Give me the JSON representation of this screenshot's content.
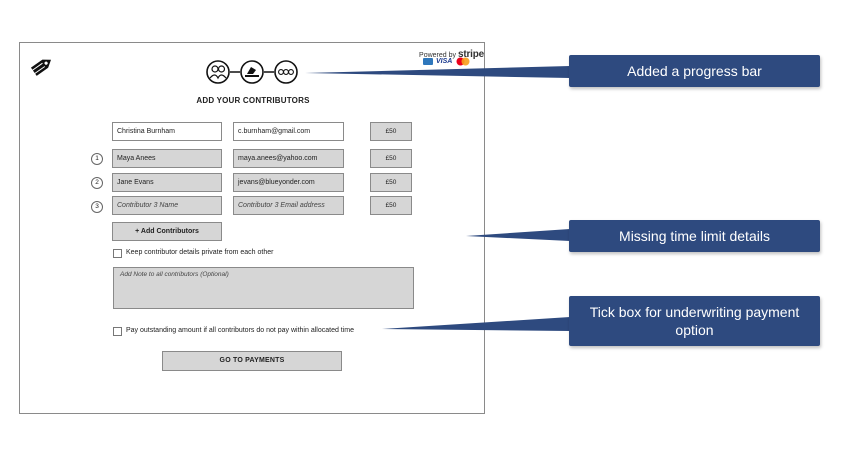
{
  "stripe": {
    "powered_by": "Powered by",
    "brand": "stripe",
    "visa": "VISA"
  },
  "page_title": "ADD YOUR CONTRIBUTORS",
  "owner": {
    "name": "Christina Burnham",
    "email": "c.burnham@gmail.com",
    "amount": "£50"
  },
  "contributors": [
    {
      "number": "1",
      "name": "Maya Anees",
      "email": "maya.anees@yahoo.com",
      "amount": "£50"
    },
    {
      "number": "2",
      "name": "Jane Evans",
      "email": "jevans@blueyonder.com",
      "amount": "£50"
    },
    {
      "number": "3",
      "name_placeholder": "Contributor 3 Name",
      "email_placeholder": "Contributor 3 Email address",
      "amount": "£50"
    }
  ],
  "add_contributors_label": "+ Add Contributors",
  "keep_private_label": "Keep contributor details private from each other",
  "note_placeholder": "Add Note to all contributors (Optional)",
  "underwrite_label": "Pay outstanding amount if all contributors do not pay within allocated time",
  "go_to_payments_label": "GO TO PAYMENTS",
  "callouts": {
    "progress": "Added a progress bar",
    "time_limit": "Missing time limit details",
    "tick_box": "Tick box for underwriting payment option"
  },
  "colors": {
    "callout_bg": "#2e4a7f",
    "field_grey": "#d6d6d6"
  }
}
